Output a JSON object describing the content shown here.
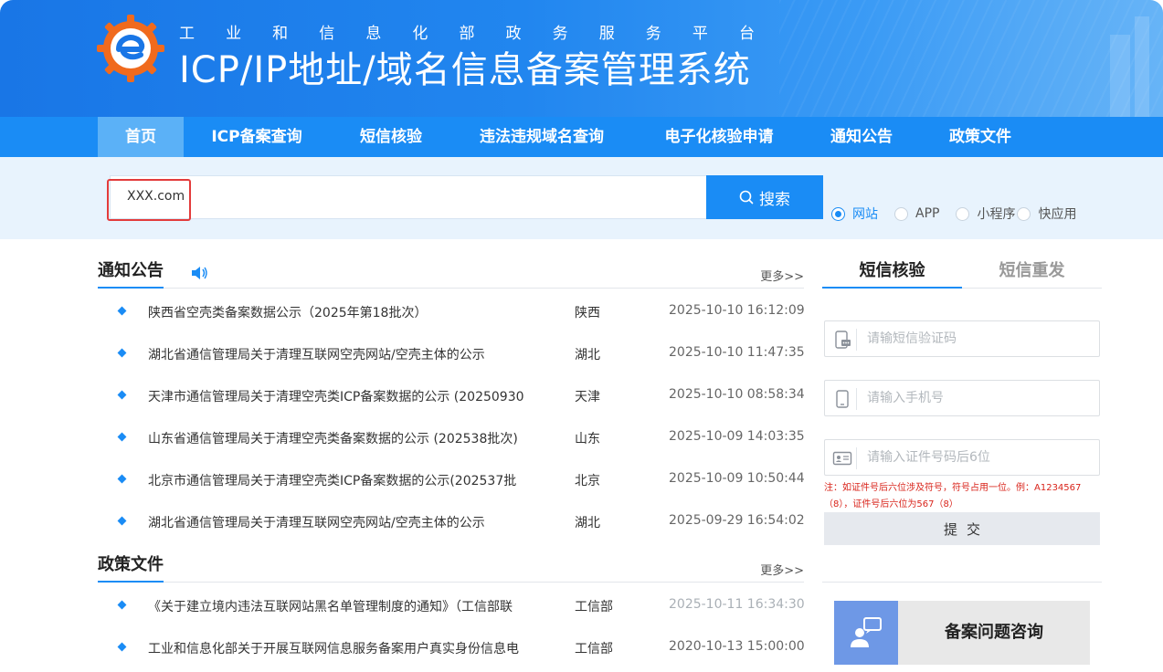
{
  "header": {
    "platform_chars": [
      "工",
      "业",
      "和",
      "信",
      "息",
      "化",
      "部",
      "政",
      "务",
      "服",
      "务",
      "平",
      "台"
    ],
    "system_title": "ICP/IP地址/域名信息备案管理系统"
  },
  "nav": {
    "items": [
      {
        "label": "首页",
        "active": true
      },
      {
        "label": "ICP备案查询"
      },
      {
        "label": "短信核验"
      },
      {
        "label": "违法违规域名查询"
      },
      {
        "label": "电子化核验申请"
      },
      {
        "label": "通知公告"
      },
      {
        "label": "政策文件"
      }
    ]
  },
  "search": {
    "value": "XXX.com",
    "button_label": "搜索",
    "types": [
      {
        "label": "网站",
        "checked": true
      },
      {
        "label": "APP"
      },
      {
        "label": "小程序"
      },
      {
        "label": "快应用"
      }
    ]
  },
  "notices": {
    "title": "通知公告",
    "more": "更多>>",
    "items": [
      {
        "title": "陕西省空壳类备案数据公示（2025年第18批次）",
        "region": "陕西",
        "date": "2025-10-10 16:12:09"
      },
      {
        "title": "湖北省通信管理局关于清理互联网空壳网站/空壳主体的公示",
        "region": "湖北",
        "date": "2025-10-10 11:47:35"
      },
      {
        "title": "天津市通信管理局关于清理空壳类ICP备案数据的公示 (20250930",
        "region": "天津",
        "date": "2025-10-10 08:58:34"
      },
      {
        "title": "山东省通信管理局关于清理空壳类备案数据的公示 (202538批次)",
        "region": "山东",
        "date": "2025-10-09 14:03:35"
      },
      {
        "title": "北京市通信管理局关于清理空壳类ICP备案数据的公示(202537批",
        "region": "北京",
        "date": "2025-10-09 10:50:44"
      },
      {
        "title": "湖北省通信管理局关于清理互联网空壳网站/空壳主体的公示",
        "region": "湖北",
        "date": "2025-09-29 16:54:02"
      }
    ]
  },
  "policies": {
    "title": "政策文件",
    "more": "更多>>",
    "items": [
      {
        "title": "《关于建立境内违法互联网站黑名单管理制度的通知》（工信部联",
        "region": "工信部",
        "date": "2025-10-11 16:34:30",
        "faded": true
      },
      {
        "title": "工业和信息化部关于开展互联网信息服务备案用户真实身份信息电",
        "region": "工信部",
        "date": "2020-10-13 15:00:00"
      }
    ]
  },
  "sms_panel": {
    "tab_active": "短信核验",
    "tab_inactive": "短信重发",
    "code_placeholder": "请输短信验证码",
    "phone_placeholder": "请输入手机号",
    "id_placeholder": "请输入证件号码后6位",
    "note": "注：如证件号后六位涉及符号，符号占用一位。例：A1234567（8），证件号后六位为567（8）",
    "submit_label": "提交"
  },
  "consult": {
    "label": "备案问题咨询"
  },
  "colors": {
    "brand_blue": "#1a8cf5",
    "nav_active": "#5bb1f7",
    "alert_red": "#d9241b"
  }
}
